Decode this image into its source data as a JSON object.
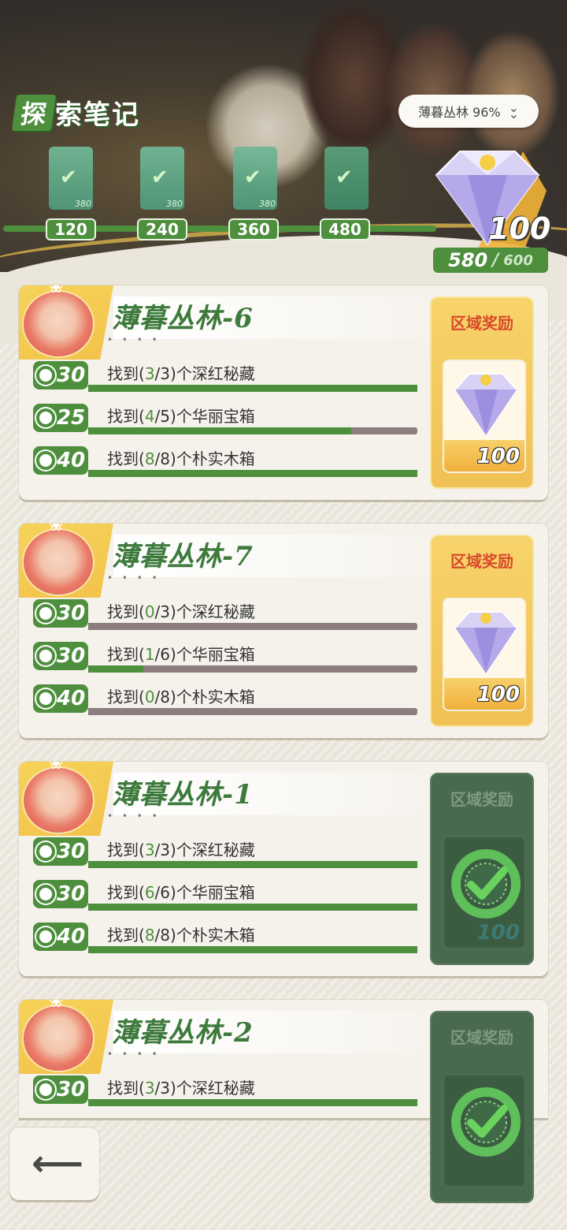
{
  "header": {
    "title_badge": "探",
    "title_rest": "索笔记",
    "area_selector": {
      "label": "薄暮丛林 96%",
      "icon": "double-chevron-down-icon"
    },
    "milestones": [
      {
        "threshold": "120",
        "reward": "380",
        "claimed": true
      },
      {
        "threshold": "240",
        "reward": "380",
        "claimed": true
      },
      {
        "threshold": "360",
        "reward": "380",
        "claimed": true
      },
      {
        "threshold": "480",
        "reward": "",
        "claimed": true
      }
    ],
    "grand_reward": {
      "count": "100",
      "icon": "diamond-gem-icon"
    },
    "points": {
      "current": "580",
      "separator": "/",
      "max": "600"
    }
  },
  "cards": [
    {
      "name": "薄暮丛林-6",
      "dots": "• • • •",
      "reward_title": "区域奖励",
      "reward_count": "100",
      "reward_claimed": false,
      "tasks": [
        {
          "points": "30",
          "pre": "找到(",
          "done": "3",
          "mid": "/3)个深红秘藏",
          "progress": 1.0
        },
        {
          "points": "25",
          "pre": "找到(",
          "done": "4",
          "mid": "/5)个华丽宝箱",
          "progress": 0.8
        },
        {
          "points": "40",
          "pre": "找到(",
          "done": "8",
          "mid": "/8)个朴实木箱",
          "progress": 1.0
        }
      ]
    },
    {
      "name": "薄暮丛林-7",
      "dots": "• • • •",
      "reward_title": "区域奖励",
      "reward_count": "100",
      "reward_claimed": false,
      "tasks": [
        {
          "points": "30",
          "pre": "找到(",
          "done": "0",
          "mid": "/3)个深红秘藏",
          "progress": 0.0
        },
        {
          "points": "30",
          "pre": "找到(",
          "done": "1",
          "mid": "/6)个华丽宝箱",
          "progress": 0.167
        },
        {
          "points": "40",
          "pre": "找到(",
          "done": "0",
          "mid": "/8)个朴实木箱",
          "progress": 0.0
        }
      ]
    },
    {
      "name": "薄暮丛林-1",
      "dots": "• • • •",
      "reward_title": "区域奖励",
      "reward_count": "100",
      "reward_claimed": true,
      "tasks": [
        {
          "points": "30",
          "pre": "找到(",
          "done": "3",
          "mid": "/3)个深红秘藏",
          "progress": 1.0
        },
        {
          "points": "30",
          "pre": "找到(",
          "done": "6",
          "mid": "/6)个华丽宝箱",
          "progress": 1.0
        },
        {
          "points": "40",
          "pre": "找到(",
          "done": "8",
          "mid": "/8)个朴实木箱",
          "progress": 1.0
        }
      ]
    },
    {
      "name": "薄暮丛林-2",
      "dots": "• • • •",
      "reward_title": "区域奖励",
      "reward_count": "",
      "reward_claimed": true,
      "tasks": [
        {
          "points": "30",
          "pre": "找到(",
          "done": "3",
          "mid": "/3)个深红秘藏",
          "progress": 1.0
        }
      ]
    }
  ],
  "back_button": {
    "icon": "back-arrow-icon"
  },
  "colors": {
    "accent_green": "#4e8f3e",
    "reward_gold": "#f0c154",
    "reward_red": "#d84a2a",
    "bar_empty": "#8c7e7e"
  }
}
